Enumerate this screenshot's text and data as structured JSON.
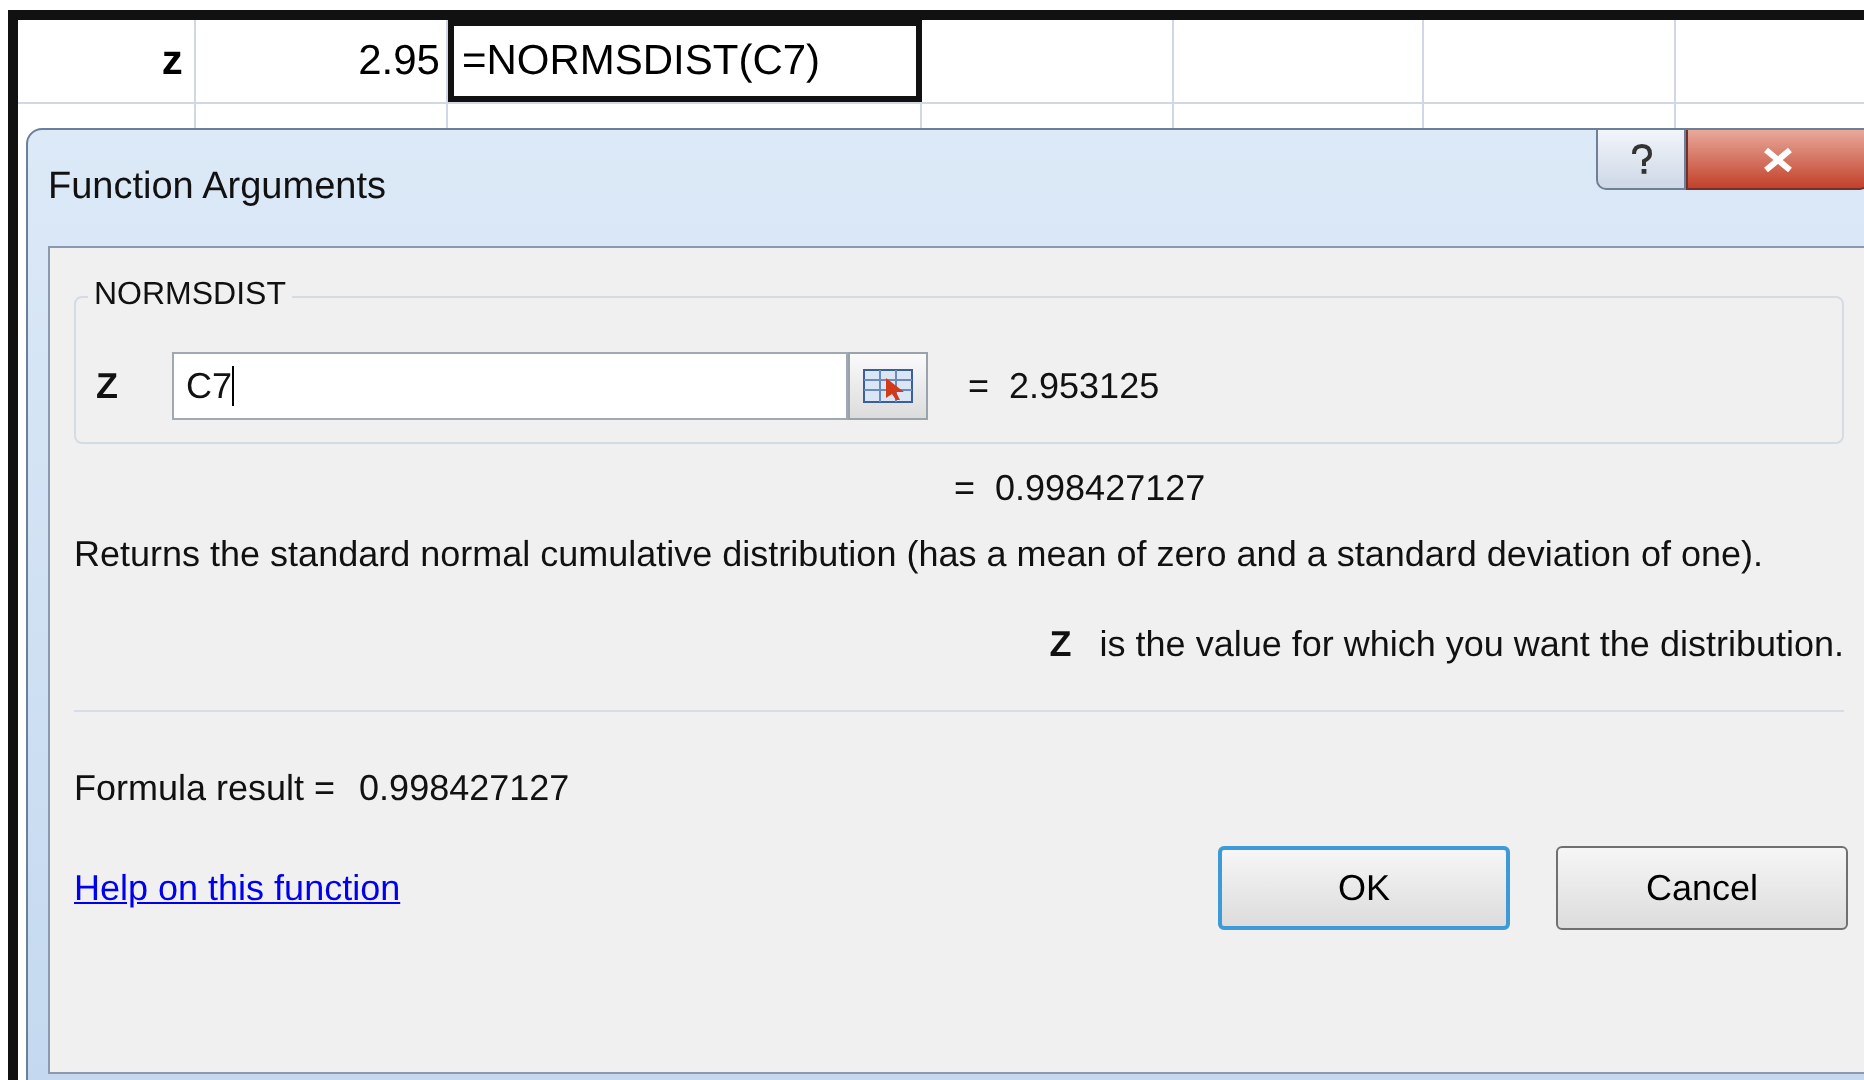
{
  "sheet": {
    "cells": [
      {
        "text": "z",
        "kind": "label",
        "selected": false
      },
      {
        "text": "2.95",
        "kind": "number",
        "selected": false
      },
      {
        "text": "=NORMSDIST(C7)",
        "kind": "formula",
        "selected": true
      }
    ]
  },
  "dialog": {
    "title": "Function Arguments",
    "function_name": "NORMSDIST",
    "arguments": [
      {
        "name": "Z",
        "value": "C7",
        "result": "=  2.953125"
      }
    ],
    "result": "=  0.998427127",
    "description": "Returns the standard normal cumulative distribution (has a mean of zero and a standard deviation of one).",
    "argument_help": {
      "name": "Z",
      "text": "is the value for which you want the distribution."
    },
    "formula_result": {
      "label": "Formula result =",
      "value": "0.998427127"
    },
    "help_link": "Help on this function",
    "buttons": [
      {
        "label": "OK",
        "default": true
      },
      {
        "label": "Cancel",
        "default": false
      }
    ]
  }
}
